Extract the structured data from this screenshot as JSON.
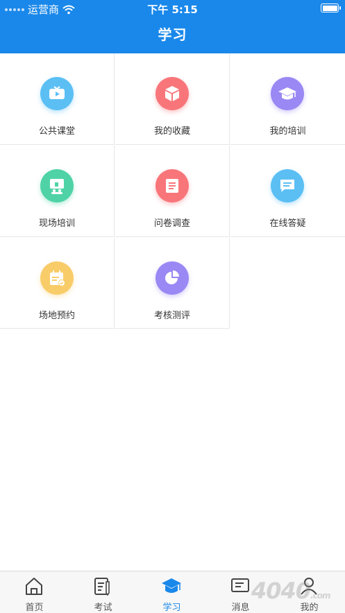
{
  "status_bar": {
    "carrier": "运营商",
    "time": "下午 5:15"
  },
  "header": {
    "title": "学习"
  },
  "grid": [
    {
      "label": "公共课堂",
      "icon": "tv-icon",
      "color": "#5bbff4"
    },
    {
      "label": "我的收藏",
      "icon": "box-icon",
      "color": "#f8767a"
    },
    {
      "label": "我的培训",
      "icon": "graduation-cap-icon",
      "color": "#9a88f4"
    },
    {
      "label": "现场培训",
      "icon": "whiteboard-icon",
      "color": "#4fd3a6"
    },
    {
      "label": "问卷调查",
      "icon": "document-icon",
      "color": "#f8767a"
    },
    {
      "label": "在线答疑",
      "icon": "chat-bubble-icon",
      "color": "#5bbff4"
    },
    {
      "label": "场地预约",
      "icon": "calendar-check-icon",
      "color": "#f9cc6a"
    },
    {
      "label": "考核测评",
      "icon": "pie-chart-icon",
      "color": "#9a88f4"
    }
  ],
  "tabbar": [
    {
      "label": "首页",
      "icon": "home-icon",
      "active": false
    },
    {
      "label": "考试",
      "icon": "exam-icon",
      "active": false
    },
    {
      "label": "学习",
      "icon": "study-icon",
      "active": true
    },
    {
      "label": "消息",
      "icon": "message-icon",
      "active": false
    },
    {
      "label": "我的",
      "icon": "profile-icon",
      "active": false
    }
  ],
  "colors": {
    "accent": "#1a88ea",
    "divider": "#e6e6e6"
  },
  "watermark": {
    "text": "4040",
    "suffix": ".com"
  }
}
